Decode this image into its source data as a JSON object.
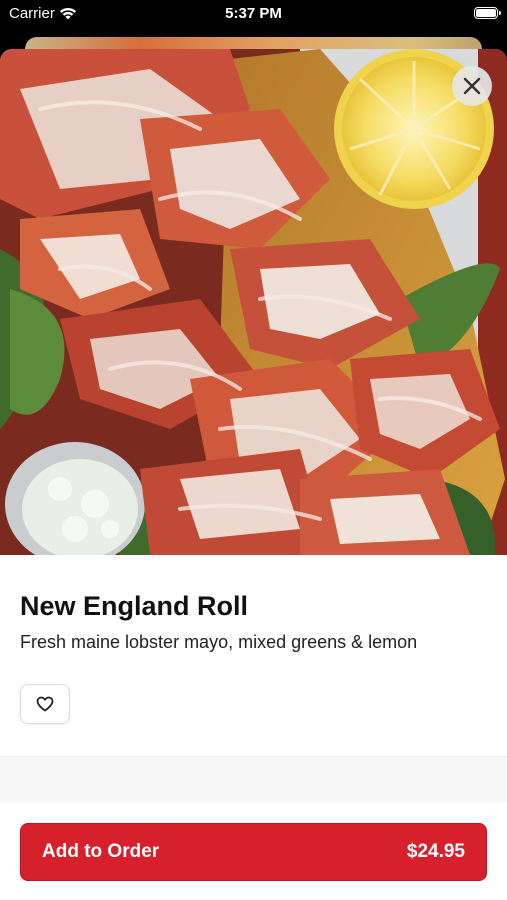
{
  "status_bar": {
    "carrier": "Carrier",
    "time": "5:37 PM",
    "icons": [
      "wifi-icon",
      "battery-icon"
    ]
  },
  "item": {
    "name": "New England Roll",
    "description": "Fresh maine lobster mayo, mixed greens & lemon",
    "price": "$24.95"
  },
  "actions": {
    "add_label": "Add to Order",
    "close_icon": "close-icon",
    "favorite_icon": "heart-icon"
  },
  "colors": {
    "accent": "#d6202c",
    "text": "#111111"
  }
}
